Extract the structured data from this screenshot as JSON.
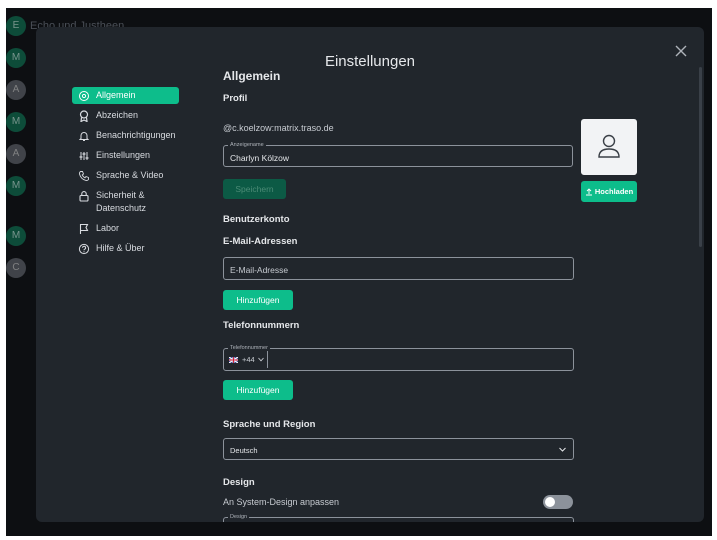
{
  "background": {
    "room_title": "Echo und Justheen"
  },
  "modal": {
    "title": "Einstellungen",
    "close_icon": "close-icon"
  },
  "nav": {
    "items": [
      {
        "label": "Allgemein",
        "icon": "gear-icon",
        "active": true
      },
      {
        "label": "Abzeichen",
        "icon": "badge-icon",
        "active": false
      },
      {
        "label": "Benachrichtigungen",
        "icon": "bell-icon",
        "active": false
      },
      {
        "label": "Einstellungen",
        "icon": "sliders-icon",
        "active": false
      },
      {
        "label": "Sprache & Video",
        "icon": "phone-icon",
        "active": false
      },
      {
        "label": "Sicherheit & Datenschutz",
        "icon": "lock-icon",
        "active": false
      },
      {
        "label": "Labor",
        "icon": "flag-icon",
        "active": false
      },
      {
        "label": "Hilfe & Über",
        "icon": "help-icon",
        "active": false
      }
    ]
  },
  "general": {
    "title": "Allgemein",
    "profile_heading": "Profil",
    "user_id": "@c.koelzow:matrix.traso.de",
    "display_name_legend": "Anzeigename",
    "display_name_value": "Charlyn Kölzow",
    "save_label": "Speichern",
    "upload_label": "Hochladen"
  },
  "account": {
    "heading": "Benutzerkonto",
    "email_heading": "E-Mail-Adressen",
    "email_placeholder": "E-Mail-Adresse",
    "email_add_label": "Hinzufügen",
    "phone_heading": "Telefonnummern",
    "phone_legend": "Telefonnummer",
    "phone_country_code": "+44",
    "phone_add_label": "Hinzufügen"
  },
  "language": {
    "heading": "Sprache und Region",
    "selected": "Deutsch"
  },
  "design": {
    "heading": "Design",
    "system_theme_label": "An System-Design anpassen",
    "system_theme_enabled": false,
    "theme_legend": "Design"
  },
  "colors": {
    "accent": "#0dbd8b",
    "modal_bg": "#21262c",
    "app_bg": "#0d0f12"
  }
}
